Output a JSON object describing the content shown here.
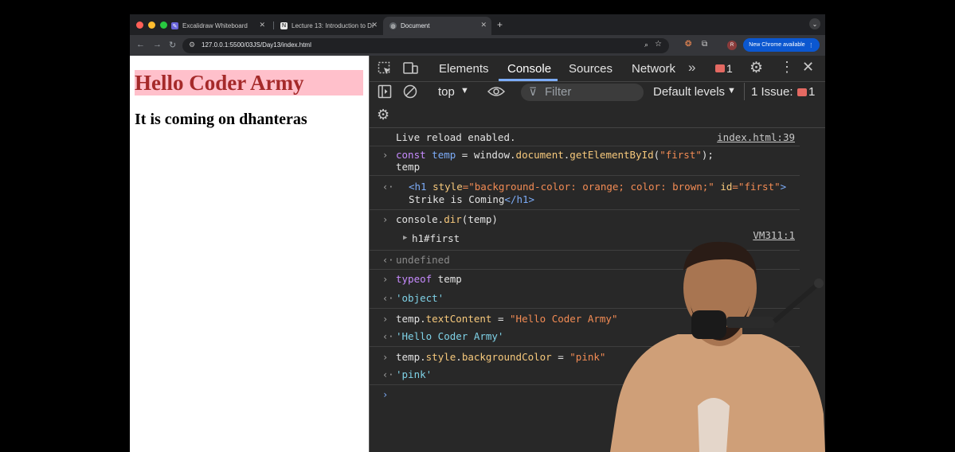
{
  "browser": {
    "tabs": [
      {
        "title": "Excalidraw Whiteboard"
      },
      {
        "title": "Lecture 13: Introduction to Di"
      },
      {
        "title": "Document"
      }
    ],
    "url": "127.0.0.1:5500/03JS/Day13/index.html",
    "update_label": "New Chrome available",
    "avatar_letter": "R"
  },
  "page": {
    "heading": "Hello Coder Army",
    "paragraph": "It is coming on dhanteras"
  },
  "devtools": {
    "tabs": [
      "Elements",
      "Console",
      "Sources",
      "Network"
    ],
    "active_tab": "Console",
    "error_count": "1",
    "context": "top",
    "filter_placeholder": "Filter",
    "levels": "Default levels",
    "issues_label": "1 Issue:",
    "issues_count": "1"
  },
  "console": {
    "live_reload": "Live reload enabled.",
    "live_reload_source": "index.html:39",
    "cmd1_a": "const",
    "cmd1_b": "temp",
    "cmd1_c": " = window.",
    "cmd1_d": "document",
    "cmd1_e": ".",
    "cmd1_f": "getElementById",
    "cmd1_g": "(",
    "cmd1_h": "\"first\"",
    "cmd1_i": ");",
    "cmd1_line2": "temp",
    "res1_open": "<h1",
    "res1_attr": " style",
    "res1_eq": "=\"background-color: orange; color: brown;\"",
    "res1_attr2": " id",
    "res1_val2": "=\"first\"",
    "res1_close": ">",
    "res1_line2": "Strike is Coming",
    "res1_end": "</h1>",
    "cmd2_a": "console.",
    "cmd2_b": "dir",
    "cmd2_c": "(temp)",
    "dir_result": "h1#first",
    "dir_source": "VM311:1",
    "undefined": "undefined",
    "cmd3_a": "typeof",
    "cmd3_b": " temp",
    "res3": "'object'",
    "cmd4_a": "temp.",
    "cmd4_b": "textContent",
    "cmd4_c": " = ",
    "cmd4_d": "\"Hello Coder Army\"",
    "res4": "'Hello Coder Army'",
    "cmd5_a": "temp.",
    "cmd5_b": "style",
    "cmd5_c": ".",
    "cmd5_d": "backgroundColor",
    "cmd5_e": " = ",
    "cmd5_f": "\"pink\"",
    "res5": "'pink'"
  },
  "colors": {
    "heading_bg": "#ffc0cb",
    "heading_fg": "#a52a2a",
    "devtools_bg": "#282828",
    "accent": "#7cacf8"
  }
}
